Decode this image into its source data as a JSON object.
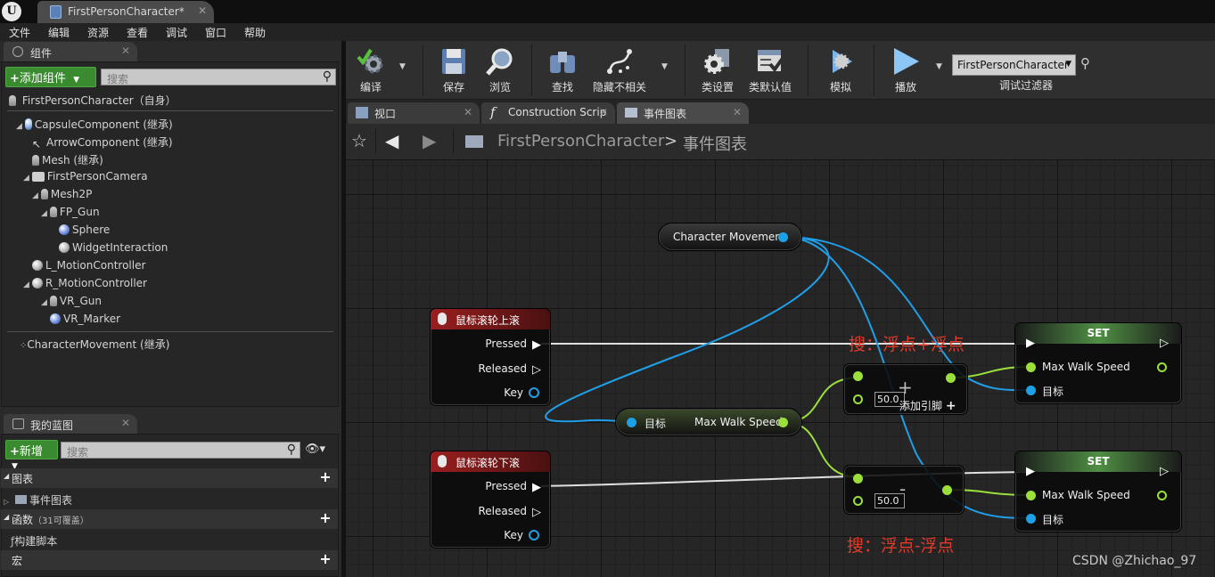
{
  "window": {
    "tab_title": "FirstPersonCharacter*",
    "tab_close": "✕"
  },
  "menu": [
    "文件",
    "编辑",
    "资源",
    "查看",
    "调试",
    "窗口",
    "帮助"
  ],
  "components_panel": {
    "tab_label": "组件",
    "add_button": "添加组件",
    "search_placeholder": "搜索",
    "root": "FirstPersonCharacter（自身）",
    "items": [
      {
        "label": "CapsuleComponent (继承)",
        "icon": "capsule-icon"
      },
      {
        "label": "ArrowComponent (继承)",
        "icon": "arrow-icon"
      },
      {
        "label": "Mesh (继承)",
        "icon": "skeletal-mesh-icon"
      },
      {
        "label": "FirstPersonCamera",
        "icon": "camera-icon"
      },
      {
        "label": "Mesh2P",
        "icon": "skeletal-mesh-icon"
      },
      {
        "label": "FP_Gun",
        "icon": "skeletal-mesh-icon"
      },
      {
        "label": "Sphere",
        "icon": "sphere-icon"
      },
      {
        "label": "WidgetInteraction",
        "icon": "widget-interaction-icon"
      },
      {
        "label": "L_MotionController",
        "icon": "motion-controller-icon"
      },
      {
        "label": "R_MotionController",
        "icon": "motion-controller-icon"
      },
      {
        "label": "VR_Gun",
        "icon": "skeletal-mesh-icon"
      },
      {
        "label": "VR_Marker",
        "icon": "sphere-icon"
      }
    ],
    "movement": "CharacterMovement (继承)"
  },
  "blueprint_panel": {
    "tab_label": "我的蓝图",
    "new_button": "新增",
    "search_placeholder": "搜索",
    "sections": {
      "graphs": "图表",
      "event_graph": "事件图表",
      "functions": "函数",
      "functions_count": "（31可覆盖）",
      "construction": "构建脚本",
      "macros": "宏"
    }
  },
  "toolbar": {
    "compile": "编译",
    "save": "保存",
    "browse": "浏览",
    "find": "查找",
    "hide_unrelated": "隐藏不相关",
    "class_settings": "类设置",
    "class_defaults": "类默认值",
    "simulate": "模拟",
    "play": "播放",
    "debug_object": "FirstPersonCharacter",
    "debug_filter": "调试过滤器"
  },
  "editor_tabs": [
    "视口",
    "Construction Scrip",
    "事件图表"
  ],
  "breadcrumb": {
    "blueprint": "FirstPersonCharacter",
    "separator": ">",
    "graph": "事件图表"
  },
  "graph": {
    "character_movement": "Character Movement",
    "wheel_up": {
      "title": "鼠标滚轮上滚",
      "pins": [
        "Pressed",
        "Released",
        "Key"
      ]
    },
    "wheel_down": {
      "title": "鼠标滚轮下滚",
      "pins": [
        "Pressed",
        "Released",
        "Key"
      ]
    },
    "get_node": {
      "target": "目标",
      "output": "Max Walk Speed"
    },
    "add_node": {
      "value": "50.0",
      "symbol": "+",
      "add_pin": "添加引脚"
    },
    "sub_node": {
      "value": "50.0",
      "symbol": "-"
    },
    "set_top": {
      "title": "SET",
      "input": "Max Walk Speed",
      "target": "目标"
    },
    "set_bottom": {
      "title": "SET",
      "input": "Max Walk Speed",
      "target": "目标"
    },
    "note_top": "搜：浮点+浮点",
    "note_bottom": "搜：浮点-浮点"
  },
  "colors": {
    "event_header": "#8c1e1e",
    "set_header": "#2f6b2f",
    "float_pin": "#9be03a",
    "object_pin": "#1ea0e6",
    "exec_wire": "#e6e6e6",
    "annotation": "#e23b2a"
  },
  "watermark": "CSDN @Zhichao_97"
}
